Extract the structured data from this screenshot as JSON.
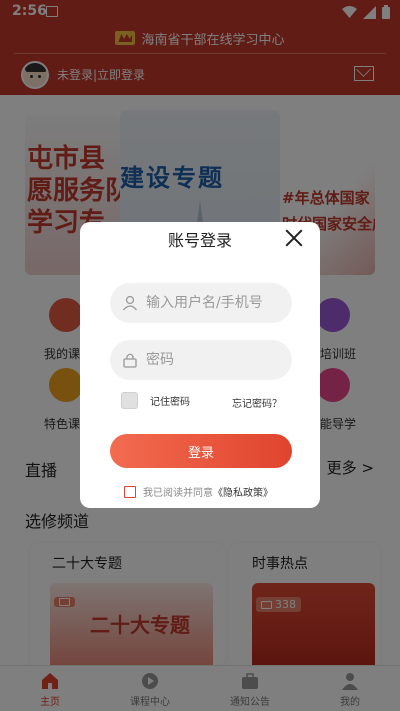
{
  "statusbar": {
    "time": "2:56"
  },
  "header": {
    "app_title": "海南省干部在线学习中心",
    "user_prompt": "未登录|立即登录"
  },
  "banners": {
    "left_text": "屯市县\n愿服务队\n学习专",
    "center_text": "建设专题",
    "right_text": "#年总体国家\n时代国家安全成"
  },
  "nav": {
    "my_courses": "我的课",
    "training": "培训班",
    "featured": "特色课",
    "smart_guide": "能导学"
  },
  "sections": {
    "live": "直播",
    "more": "更多 >",
    "channels": "选修频道"
  },
  "cards": [
    {
      "title": "二十大专题",
      "image_text": "二十大专题",
      "badge": ""
    },
    {
      "title": "时事热点",
      "badge": "338"
    }
  ],
  "tabs": [
    {
      "label": "主页"
    },
    {
      "label": "课程中心"
    },
    {
      "label": "通知公告"
    },
    {
      "label": "我的"
    }
  ],
  "dialog": {
    "title": "账号登录",
    "username_placeholder": "输入用户名/手机号",
    "password_placeholder": "密码",
    "remember_label": "记住密码",
    "forgot_label": "忘记密码？",
    "login_label": "登录",
    "agree_prefix": "我已阅读并同意",
    "policy_label": "《隐私政策》"
  },
  "colors": {
    "brand_red": "#c0392b",
    "accent_red": "#e0442e"
  }
}
